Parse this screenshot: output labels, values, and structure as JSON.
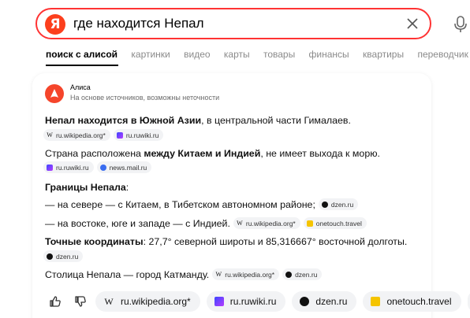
{
  "search": {
    "logo": "Я",
    "query": "где находится Непал"
  },
  "tabs": [
    {
      "label": "поиск с алисой",
      "active": true
    },
    {
      "label": "картинки"
    },
    {
      "label": "видео"
    },
    {
      "label": "карты"
    },
    {
      "label": "товары"
    },
    {
      "label": "финансы"
    },
    {
      "label": "квартиры"
    },
    {
      "label": "переводчик"
    },
    {
      "label": "в"
    }
  ],
  "answer": {
    "author": "Алиса",
    "disclaimer": "На основе источников, возможны неточности",
    "p1": {
      "bold": "Непал находится в Южной Азии",
      "rest": ", в центральной части Гималаев."
    },
    "p1_sources": [
      "ru.wikipedia.org*",
      "ru.ruwiki.ru"
    ],
    "p2": {
      "pre": "Страна расположена ",
      "bold": "между Китаем и Индией",
      "rest": ", не имеет выхода к морю."
    },
    "p2_sources": [
      "ru.ruwiki.ru",
      "news.mail.ru"
    ],
    "borders_heading": "Границы Непала",
    "borders_colon": ":",
    "border1": "— на севере — с Китаем, в Тибетском автономном районе;",
    "border1_source": "dzen.ru",
    "border2": "— на востоке, юге и западе — с Индией.",
    "border2_sources": [
      "ru.wikipedia.org*",
      "onetouch.travel"
    ],
    "coords": {
      "bold": "Точные координаты",
      "rest": ": 27,7° северной широты и 85,316667° восточной долготы."
    },
    "coords_source": "dzen.ru",
    "capital": "Столица Непала — город Катманду.",
    "capital_sources": [
      "ru.wikipedia.org*",
      "dzen.ru"
    ]
  },
  "footer_sources": [
    "ru.wikipedia.org*",
    "ru.ruwiki.ru",
    "dzen.ru",
    "onetouch.travel"
  ],
  "colors": {
    "accent": "#fc3f1d",
    "border": "#ff3333"
  }
}
